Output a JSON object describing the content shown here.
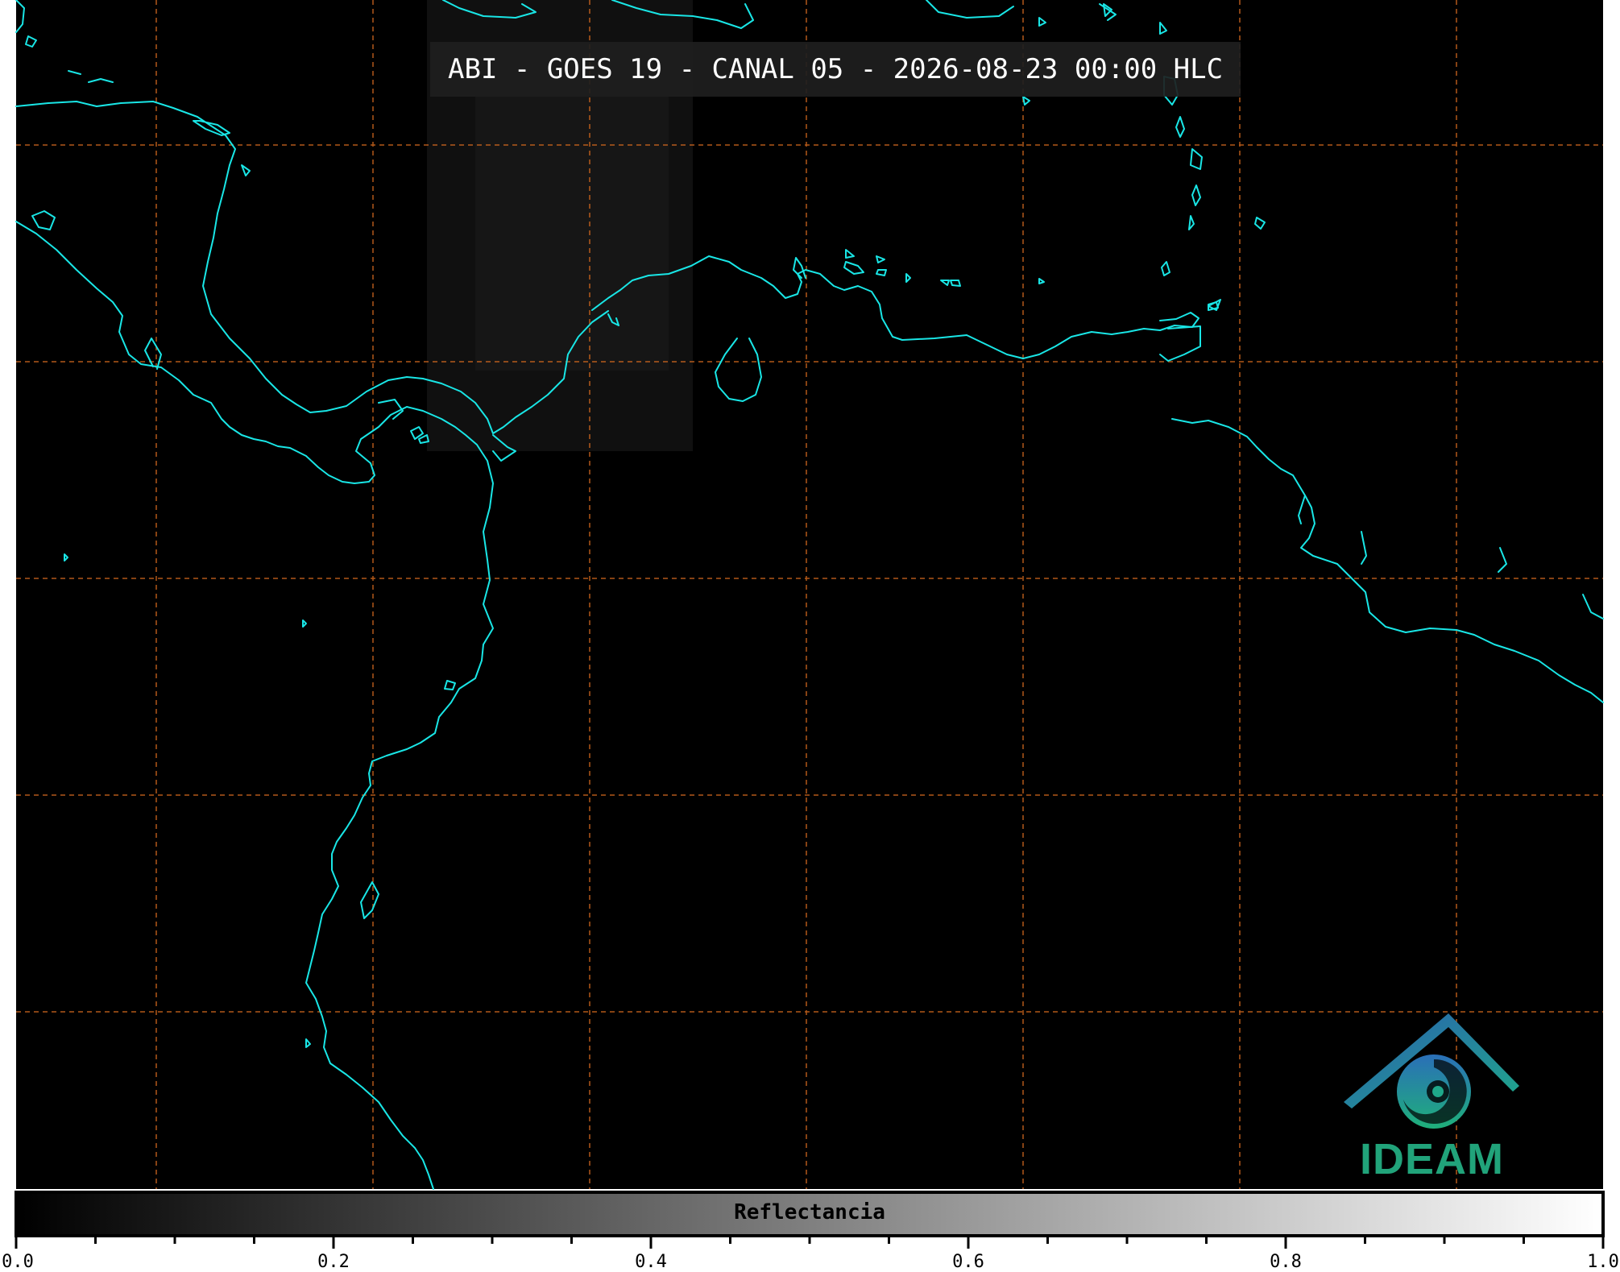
{
  "title": "ABI - GOES 19 - CANAL 05 - 2026-08-23 00:00 HLC",
  "logo": {
    "text": "IDEAM"
  },
  "colorbar": {
    "label": "Reflectancia",
    "range": [
      0.0,
      1.0
    ],
    "colormap": [
      "#000000",
      "#ffffff"
    ],
    "major_ticks": [
      {
        "value": 0.0,
        "label": "0.0"
      },
      {
        "value": 0.2,
        "label": "0.2"
      },
      {
        "value": 0.4,
        "label": "0.4"
      },
      {
        "value": 0.6,
        "label": "0.6"
      },
      {
        "value": 0.8,
        "label": "0.8"
      },
      {
        "value": 1.0,
        "label": "1.0"
      }
    ],
    "minor_tick_step": 0.05
  },
  "colors": {
    "background": "#000000",
    "coastline": "#19e6e6",
    "gridlines": "#d2691e",
    "logo_blue": "#2a5fb0",
    "logo_teal": "#1fa88a"
  },
  "map": {
    "gridlines": "dashed",
    "coastlines": true
  }
}
